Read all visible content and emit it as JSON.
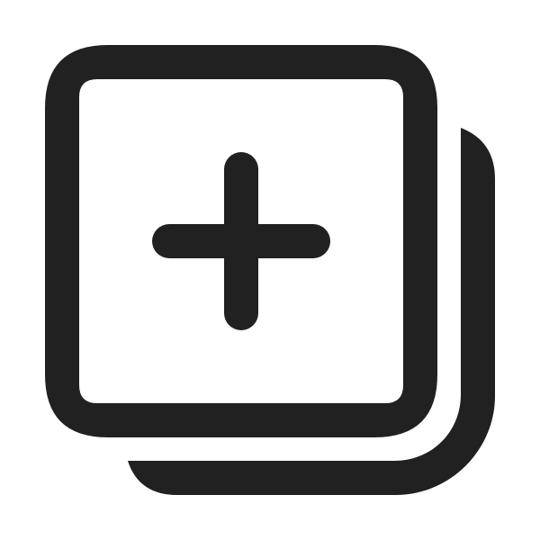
{
  "icon": {
    "semantic": "add-square-multiple-icon",
    "description_color": "#212121",
    "background": "#ffffff"
  }
}
